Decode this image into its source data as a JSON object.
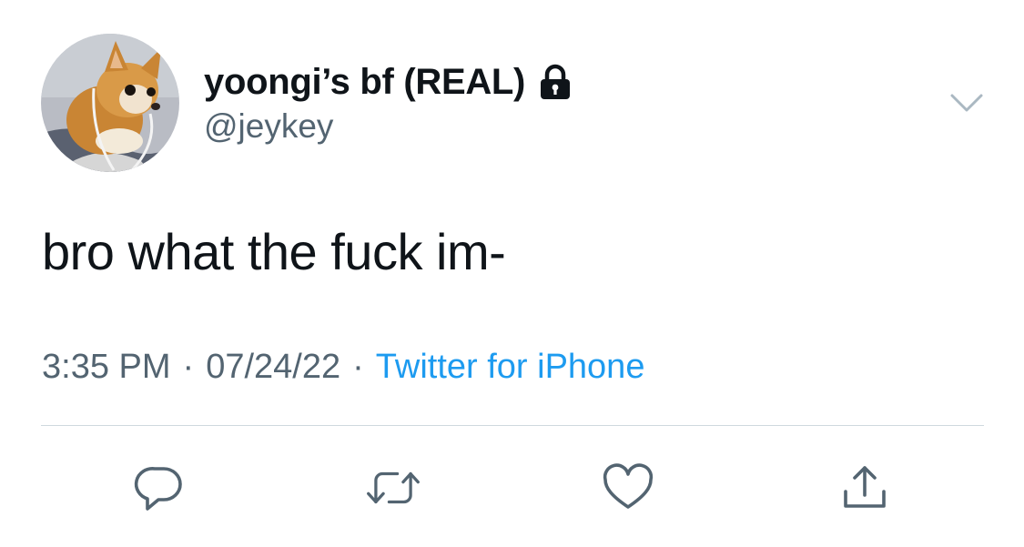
{
  "tweet": {
    "author": {
      "display_name": "yoongi’s bf (REAL)",
      "handle": "@jeykey",
      "avatar_icon": "chihuahua-avatar",
      "locked": true,
      "lock_icon": "lock-icon"
    },
    "menu_icon": "chevron-down-icon",
    "text": "bro what the fuck im-",
    "time": "3:35 PM",
    "separator": "·",
    "date": "07/24/22",
    "source": "Twitter for iPhone",
    "actions": [
      {
        "name": "reply",
        "icon": "reply-bubble-icon"
      },
      {
        "name": "retweet",
        "icon": "retweet-icon"
      },
      {
        "name": "like",
        "icon": "heart-icon"
      },
      {
        "name": "share",
        "icon": "share-icon"
      }
    ],
    "colors": {
      "text": "#0f1419",
      "secondary": "#536471",
      "link": "#1d9bf0",
      "icon": "#536471",
      "divider": "#cfd9de"
    }
  }
}
